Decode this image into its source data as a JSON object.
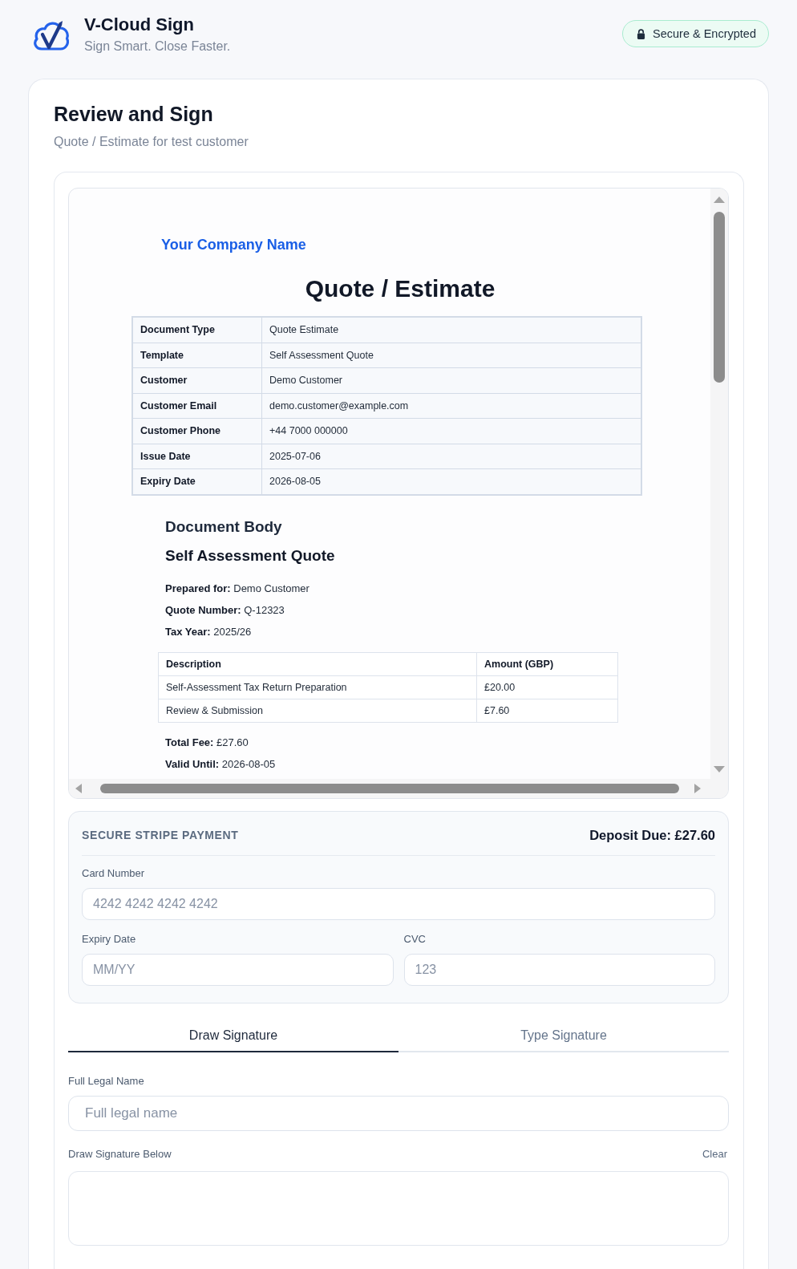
{
  "header": {
    "title": "V-Cloud Sign",
    "tagline": "Sign Smart. Close Faster.",
    "badge": "Secure & Encrypted"
  },
  "page": {
    "title": "Review and Sign",
    "subtitle": "Quote / Estimate for test customer"
  },
  "document": {
    "company": "Your Company Name",
    "title": "Quote / Estimate",
    "details": [
      {
        "label": "Document Type",
        "value": "Quote Estimate"
      },
      {
        "label": "Template",
        "value": "Self Assessment Quote"
      },
      {
        "label": "Customer",
        "value": "Demo Customer"
      },
      {
        "label": "Customer Email",
        "value": "demo.customer@example.com"
      },
      {
        "label": "Customer Phone",
        "value": "+44 7000 000000"
      },
      {
        "label": "Issue Date",
        "value": "2025-07-06"
      },
      {
        "label": "Expiry Date",
        "value": "2026-08-05"
      }
    ],
    "body_heading": "Document Body",
    "quote_title": "Self Assessment Quote",
    "facts": [
      "**Prepared for:** Demo Customer",
      "**Quote Number:** Q-12323",
      "**Tax Year:** 2025/26"
    ],
    "line_items": {
      "columns": [
        "Description",
        "Amount (GBP)"
      ],
      "rows": [
        [
          "Self-Assessment Tax Return Preparation",
          "£20.00"
        ],
        [
          "Review & Submission",
          "£7.60"
        ]
      ]
    },
    "totals": [
      "**Total Fee:** £27.60",
      "**Valid Until:** 2026-08-05"
    ]
  },
  "payment": {
    "title": "SECURE STRIPE PAYMENT",
    "deposit": "Deposit Due: £27.60",
    "fields": [
      {
        "label": "Card Number",
        "placeholder": "4242 4242 4242 4242"
      },
      {
        "label": "Expiry Date",
        "placeholder": "MM/YY"
      },
      {
        "label": "CVC",
        "placeholder": "123"
      }
    ]
  },
  "signature": {
    "tabs": [
      {
        "label": "Draw Signature",
        "selected": true
      },
      {
        "label": "Type Signature",
        "selected": false
      }
    ],
    "name_field": {
      "label": "Full Legal Name",
      "placeholder": "Full legal name"
    },
    "pad": {
      "label": "Draw Signature Below",
      "clear": "Clear"
    }
  }
}
